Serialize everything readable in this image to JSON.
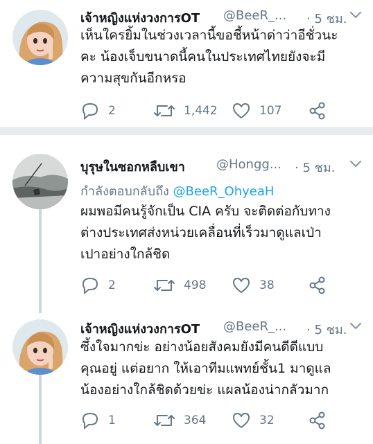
{
  "tweets": [
    {
      "name": "เจ้าหญิงแห่งวงการOT",
      "handle": "@BeeR_...",
      "time": "· 5 ชม.",
      "text_lines": [
        "เห็นใครยิ้มในช่วงเวลานี้ขอชี้หน้าด่าว่าอีชั่วนะ",
        "คะ น้องเจ็บขนาดนี้คนในประเทศไทยยังจะมี",
        "ความสุขกันอีกหรอ"
      ],
      "replies": "2",
      "retweets": "1,442",
      "likes": "107"
    },
    {
      "name": "บุรุษในซอกหลืบเขา",
      "handle": "@Hongg...",
      "time": "· 5 ชม.",
      "reply_prefix": "กำลังตอบกลับถึง",
      "reply_mention": "@BeeR_OhyeaH",
      "text_lines": [
        "ผมพอมีคนรู้จักเป็น CIA ครับ จะติดต่อกับทาง",
        "ต่างประเทศส่งหน่วยเคลื่อนที่เร็วมาดูแลเป่า",
        "เปาอย่างใกล้ชิด"
      ],
      "replies": "2",
      "retweets": "498",
      "likes": "38"
    },
    {
      "name": "เจ้าหญิงแห่งวงการOT",
      "handle": "@BeeR_...",
      "time": "· 5 ชม.",
      "text_lines": [
        "ซึ้งใจมากข่ะ อย่างน้อยสังคมยังมีคนดีดีแบบ",
        "คุณอยู่ แต่อยาก ให้เอาทีมแพทย์ชั้น1 มาดูแล",
        "น้องอย่างใกล้ชิดด้วยข่ะ แผลน้องน่ากลัวมาก"
      ],
      "replies": "1",
      "retweets": "364",
      "likes": "32"
    }
  ],
  "colors": {
    "primary_text": "#14171a",
    "secondary_text": "#657786",
    "link": "#1da1f2",
    "separator": "#e6ecf0",
    "thread_line": "#ccd6dd"
  },
  "icons": [
    "reply-icon",
    "retweet-icon",
    "like-icon",
    "share-icon",
    "chevron-down-icon"
  ]
}
